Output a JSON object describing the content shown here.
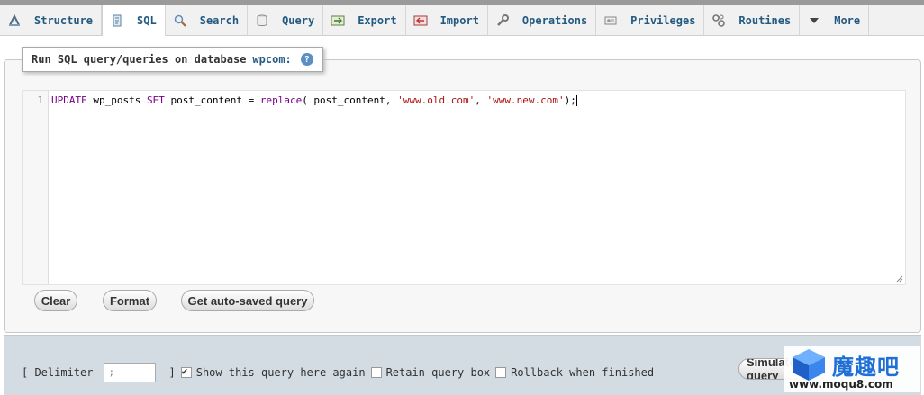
{
  "tabs": [
    {
      "label": "Structure",
      "icon": "structure-icon"
    },
    {
      "label": "SQL",
      "icon": "sql-icon",
      "active": true
    },
    {
      "label": "Search",
      "icon": "search-icon"
    },
    {
      "label": "Query",
      "icon": "query-icon"
    },
    {
      "label": "Export",
      "icon": "export-icon"
    },
    {
      "label": "Import",
      "icon": "import-icon"
    },
    {
      "label": "Operations",
      "icon": "wrench-icon"
    },
    {
      "label": "Privileges",
      "icon": "privileges-icon"
    },
    {
      "label": "Routines",
      "icon": "routines-icon"
    },
    {
      "label": "More",
      "icon": "chevron-down-icon"
    }
  ],
  "legend": {
    "text": "Run SQL query/queries on database",
    "db": "wpcom:",
    "help_icon": "help-icon"
  },
  "editor": {
    "line_number": "1",
    "tokens": {
      "t1": "UPDATE",
      "t2": " wp_posts ",
      "t3": "SET",
      "t4": " post_content = ",
      "t5": "replace",
      "t6": "( post_content, ",
      "t7": "'www.old.com'",
      "t8": ", ",
      "t9": "'www.new.com'",
      "t10": ");"
    }
  },
  "buttons": {
    "clear": "Clear",
    "format": "Format",
    "autosaved": "Get auto-saved query"
  },
  "footer": {
    "delimiter_label_open": "[ Delimiter",
    "delimiter_value": ";",
    "delimiter_label_close": "]",
    "show_query": "Show this query here again",
    "show_query_checked": true,
    "retain": "Retain query box",
    "retain_checked": false,
    "rollback": "Rollback when finished",
    "rollback_checked": false,
    "simulate": "Simulate query"
  },
  "watermark": {
    "title": "魔趣吧",
    "url": "www.moqu8.com"
  },
  "colors": {
    "link": "#235a81",
    "footer_bg": "#d3dce3",
    "keyword": "#770088",
    "string": "#aa1111"
  }
}
